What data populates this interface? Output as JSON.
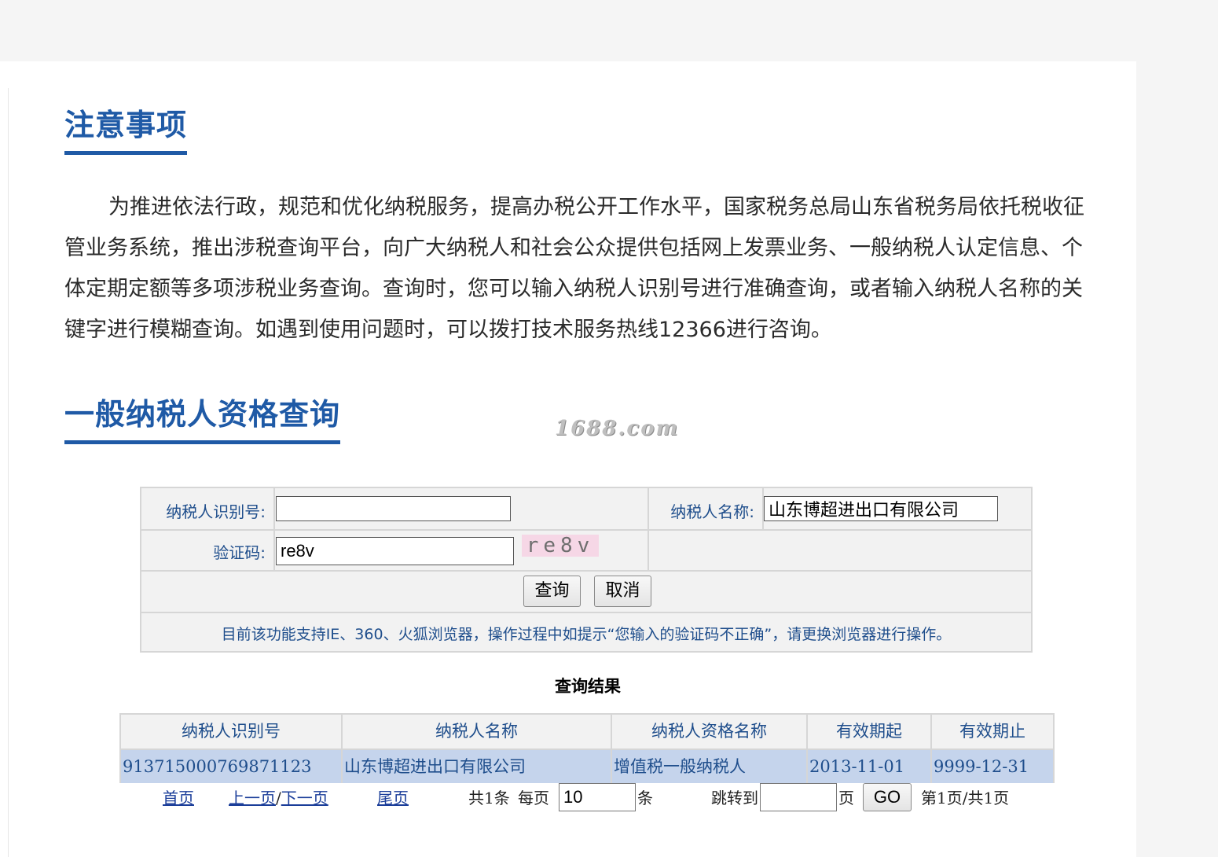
{
  "notice": {
    "title": "注意事项",
    "body": "为推进依法行政，规范和优化纳税服务，提高办税公开工作水平，国家税务总局山东省税务局依托税收征管业务系统，推出涉税查询平台，向广大纳税人和社会公众提供包括网上发票业务、一般纳税人认定信息、个体定期定额等多项涉税业务查询。查询时，您可以输入纳税人识别号进行准确查询，或者输入纳税人名称的关键字进行模糊查询。如遇到使用问题时，可以拨打技术服务热线12366进行咨询。"
  },
  "watermark": "1688.com",
  "query": {
    "title": "一般纳税人资格查询",
    "taxpayer_id_label": "纳税人识别号:",
    "taxpayer_id_value": "",
    "taxpayer_name_label": "纳税人名称:",
    "taxpayer_name_value": "山东博超进出口有限公司",
    "captcha_label": "验证码:",
    "captcha_value": "re8v",
    "captcha_image_text": "re8v",
    "search_button": "查询",
    "cancel_button": "取消",
    "tip": "目前该功能支持IE、360、火狐浏览器，操作过程中如提示“您输入的验证码不正确”，请更换浏览器进行操作。"
  },
  "results": {
    "title": "查询结果",
    "columns": [
      "纳税人识别号",
      "纳税人名称",
      "纳税人资格名称",
      "有效期起",
      "有效期止"
    ],
    "rows": [
      [
        "913715000769871123",
        "山东博超进出口有限公司",
        "增值税一般纳税人",
        "2013-11-01",
        "9999-12-31"
      ]
    ]
  },
  "pager": {
    "first": "首页",
    "prev": "上一页",
    "separator": "/",
    "next": "下一页",
    "last": "尾页",
    "total": "共1条",
    "per_page_label": "每页",
    "per_page_value": "10",
    "per_page_unit": "条",
    "jump_label": "跳转到",
    "jump_value": "",
    "jump_unit": "页",
    "go_button": "GO",
    "page_info": "第1页/共1页"
  }
}
